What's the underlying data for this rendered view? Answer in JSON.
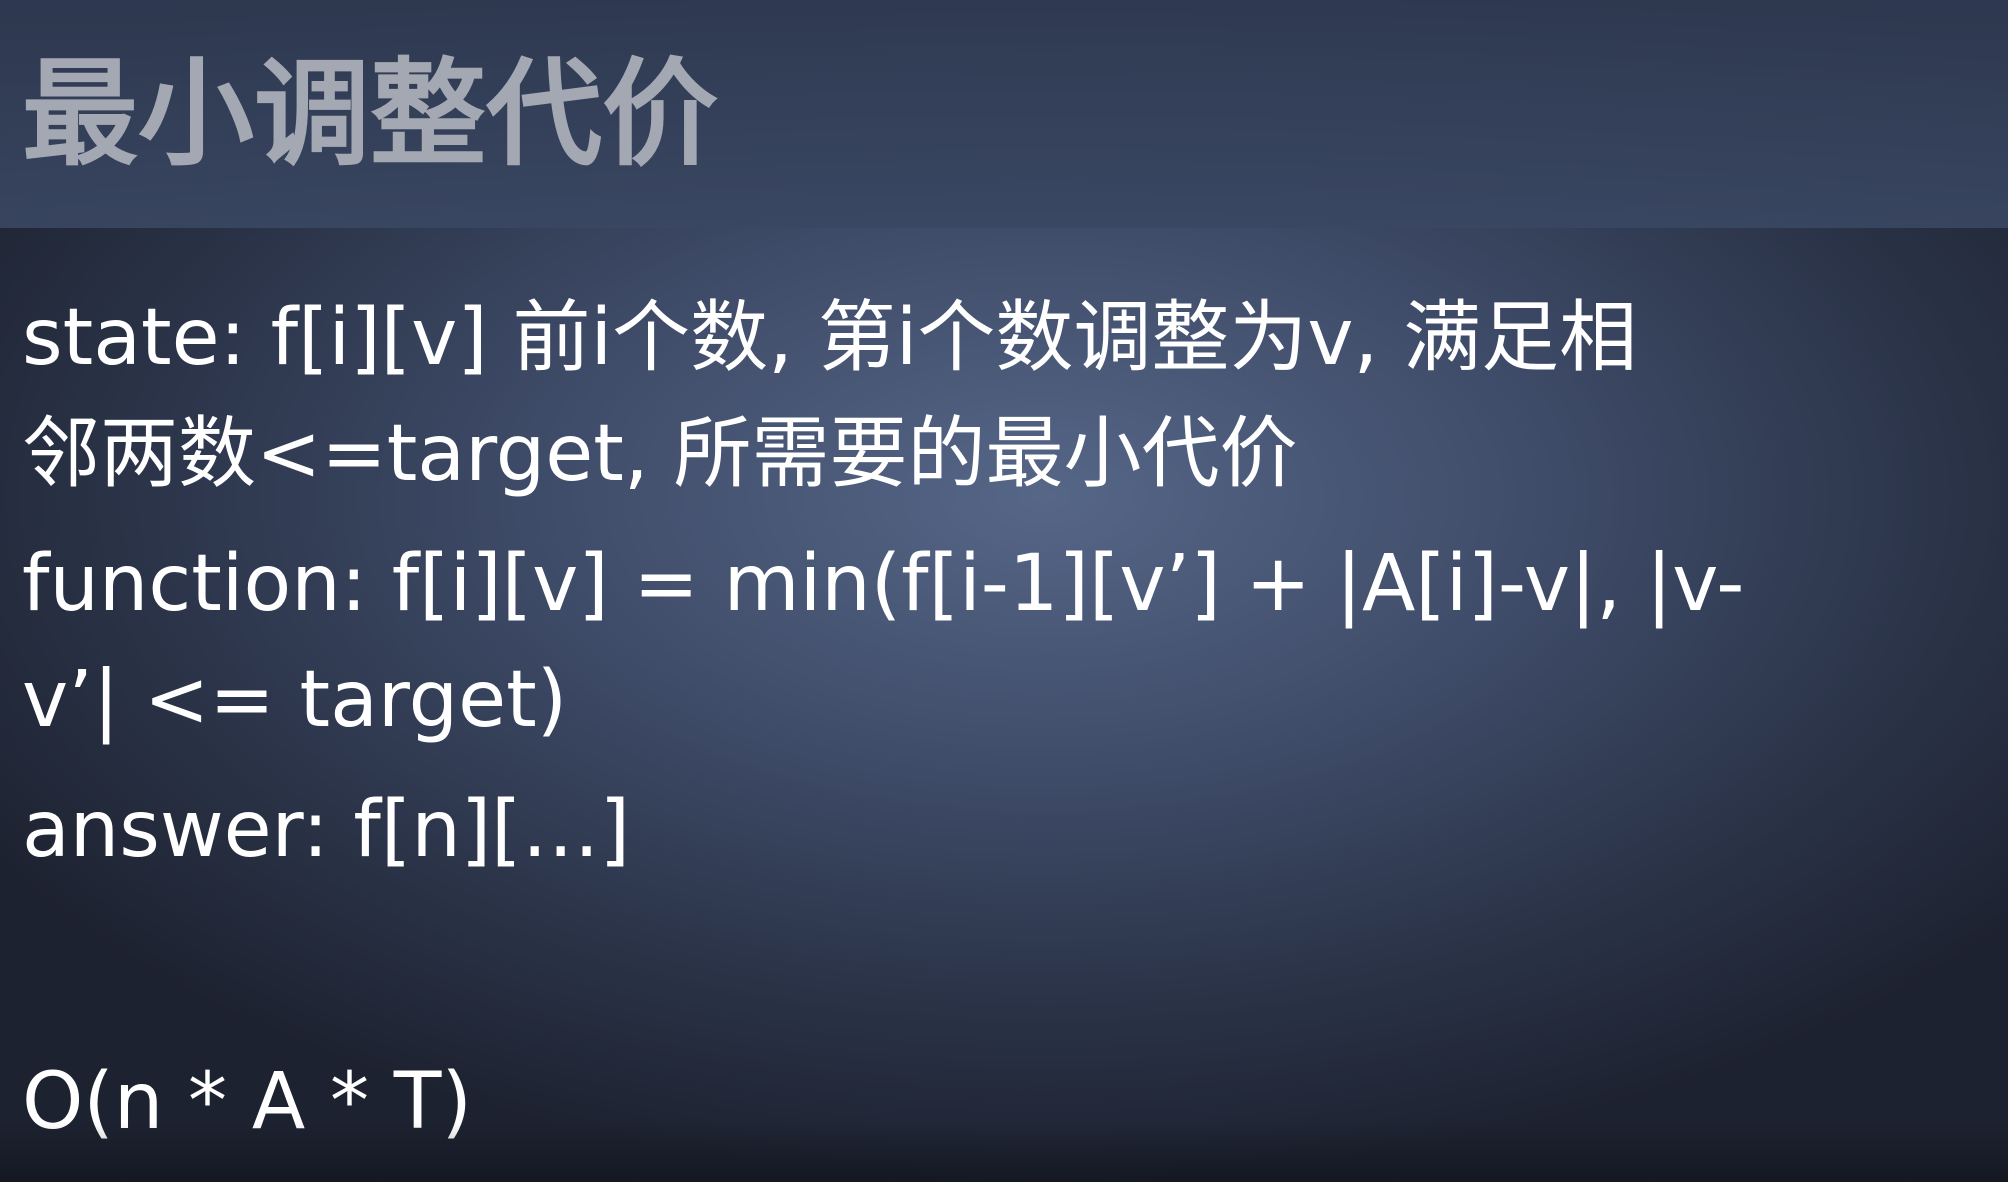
{
  "slide": {
    "title": "最小调整代价",
    "lines": {
      "state_1": "state: f[i][v] 前i个数, 第i个数调整为v, 满足相",
      "state_2": "邻两数<=target, 所需要的最小代价",
      "function_1": "function: f[i][v] = min(f[i-1][v’] + |A[i]-v|, |v-",
      "function_2": "v’| <= target)",
      "answer": "answer: f[n][…]",
      "complexity": "O(n * A * T)"
    }
  }
}
